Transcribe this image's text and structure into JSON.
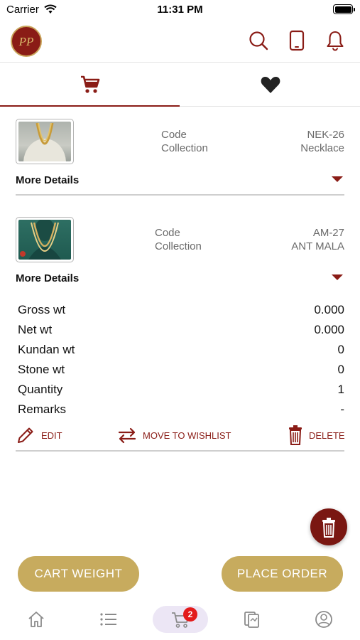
{
  "status_bar": {
    "carrier": "Carrier",
    "time": "11:31 PM"
  },
  "header": {
    "logo_text": "PP",
    "icons": [
      "search-icon",
      "phone-icon",
      "bell-icon"
    ]
  },
  "tabs": [
    {
      "icon": "cart-icon",
      "active": true
    },
    {
      "icon": "heart-icon",
      "active": false
    }
  ],
  "cart_items": [
    {
      "code_label": "Code",
      "collection_label": "Collection",
      "code": "NEK-26",
      "collection": "Necklace",
      "more_details_label": "More Details",
      "expanded": false
    },
    {
      "code_label": "Code",
      "collection_label": "Collection",
      "code": "AM-27",
      "collection": "ANT MALA",
      "more_details_label": "More Details",
      "expanded": true,
      "details": [
        {
          "label": "Gross wt",
          "value": "0.000"
        },
        {
          "label": "Net wt",
          "value": "0.000"
        },
        {
          "label": "Kundan wt",
          "value": "0"
        },
        {
          "label": "Stone wt",
          "value": "0"
        },
        {
          "label": "Quantity",
          "value": "1"
        },
        {
          "label": "Remarks",
          "value": "-"
        }
      ],
      "actions": {
        "edit": "EDIT",
        "move": "MOVE TO WISHLIST",
        "delete": "DELETE"
      }
    }
  ],
  "buttons": {
    "cart_weight": "CART WEIGHT",
    "place_order": "PLACE ORDER"
  },
  "bottom_nav": {
    "items": [
      "home-icon",
      "list-icon",
      "cart-icon",
      "catalog-icon",
      "profile-icon"
    ],
    "cart_badge": "2"
  },
  "colors": {
    "brand": "#8a1c16",
    "gold": "#c7ab5e",
    "badge": "#e31b1b"
  }
}
